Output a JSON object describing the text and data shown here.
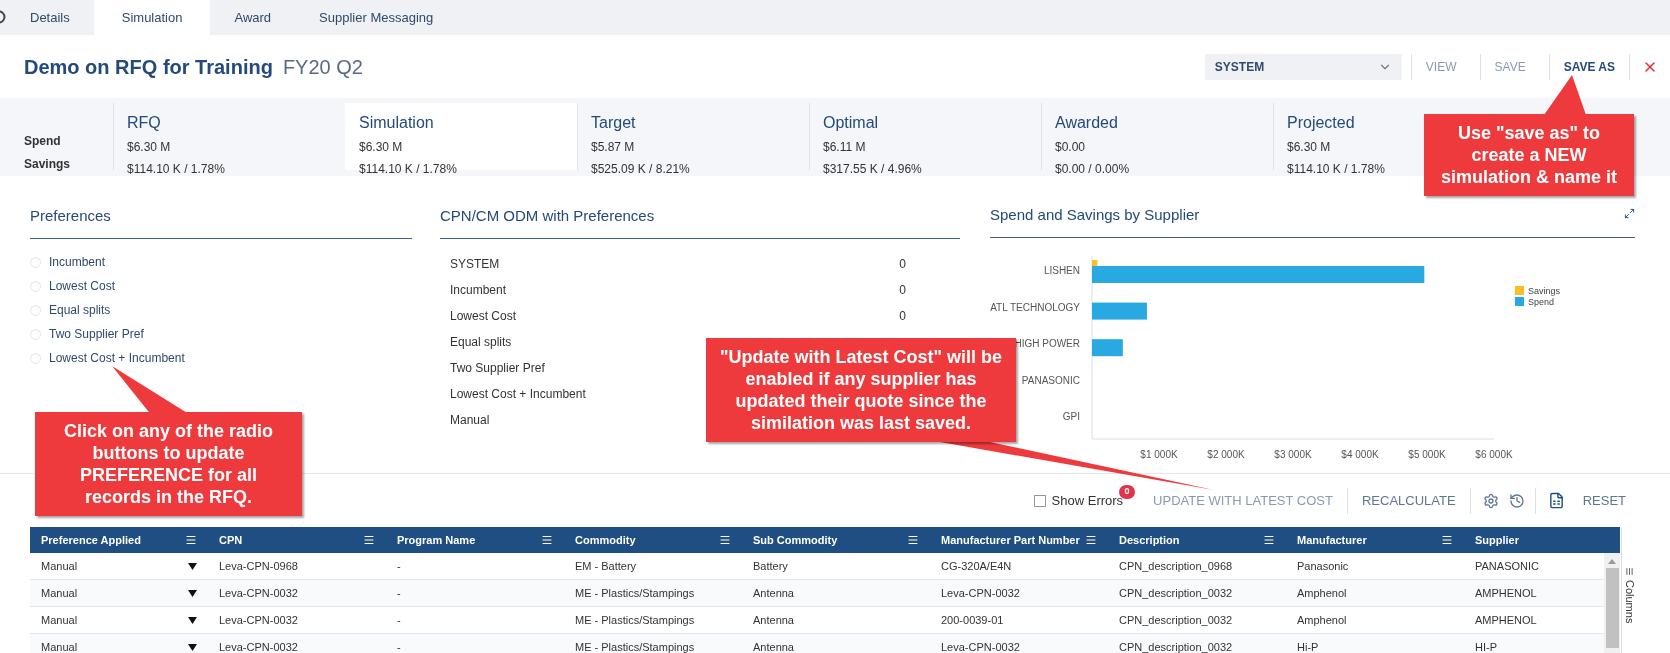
{
  "tabs": [
    {
      "label": "Details",
      "selected": false
    },
    {
      "label": "Simulation",
      "selected": true
    },
    {
      "label": "Award",
      "selected": false
    },
    {
      "label": "Supplier Messaging",
      "selected": false
    }
  ],
  "header": {
    "title": "Demo on RFQ for Training",
    "subtitle": "FY20 Q2",
    "view_select": "SYSTEM",
    "buttons": [
      {
        "label": "VIEW",
        "disabled": true
      },
      {
        "label": "SAVE",
        "disabled": true
      },
      {
        "label": "SAVE AS",
        "disabled": false
      }
    ]
  },
  "summary": {
    "row_labels": [
      "Spend",
      "Savings"
    ],
    "cards": [
      {
        "title": "RFQ",
        "spend": "$6.30 M",
        "savings": "$114.10 K / 1.78%",
        "selected": false
      },
      {
        "title": "Simulation",
        "spend": "$6.30 M",
        "savings": "$114.10 K / 1.78%",
        "selected": true
      },
      {
        "title": "Target",
        "spend": "$5.87 M",
        "savings": "$525.09 K / 8.21%",
        "selected": false
      },
      {
        "title": "Optimal",
        "spend": "$6.11 M",
        "savings": "$317.55 K / 4.96%",
        "selected": false
      },
      {
        "title": "Awarded",
        "spend": "$0.00",
        "savings": "$0.00 / 0.00%",
        "selected": false
      },
      {
        "title": "Projected",
        "spend": "$6.30 M",
        "savings": "$114.10 K / 1.78%",
        "selected": false
      }
    ]
  },
  "preferences": {
    "title": "Preferences",
    "options": [
      {
        "label": "Incumbent",
        "checked": false
      },
      {
        "label": "Lowest Cost",
        "checked": false
      },
      {
        "label": "Equal splits",
        "checked": false
      },
      {
        "label": "Two Supplier Pref",
        "checked": false
      },
      {
        "label": "Lowest Cost + Incumbent",
        "checked": false
      }
    ]
  },
  "cpn_panel": {
    "title": "CPN/CM ODM with Preferences",
    "rows": [
      {
        "label": "SYSTEM",
        "value": "0"
      },
      {
        "label": "Incumbent",
        "value": "0"
      },
      {
        "label": "Lowest Cost",
        "value": "0"
      },
      {
        "label": "Equal splits"
      },
      {
        "label": "Two Supplier Pref"
      },
      {
        "label": "Lowest Cost + Incumbent"
      },
      {
        "label": "Manual"
      }
    ]
  },
  "chart_panel": {
    "title": "Spend and Savings by Supplier",
    "chart_data": {
      "type": "bar",
      "orientation": "horizontal",
      "legend": "right",
      "categories": [
        "LISHEN",
        "ATL TECHNOLOGY",
        "HIGH POWER",
        "PANASONIC",
        "GPI"
      ],
      "series": [
        {
          "name": "Savings",
          "color": "#fbbf24",
          "values": [
            80,
            0,
            0,
            0,
            0
          ]
        },
        {
          "name": "Spend",
          "color": "#29a9e1",
          "values": [
            4960,
            820,
            460,
            0,
            0
          ]
        }
      ],
      "xlim": [
        0,
        6000
      ],
      "xticks": [
        {
          "value": 1000,
          "label": "$1 000K"
        },
        {
          "value": 2000,
          "label": "$2 000K"
        },
        {
          "value": 3000,
          "label": "$3 000K"
        },
        {
          "value": 4000,
          "label": "$4 000K"
        },
        {
          "value": 5000,
          "label": "$5 000K"
        },
        {
          "value": 6000,
          "label": "$6 000K"
        }
      ]
    }
  },
  "toolbar": {
    "show_errors": {
      "label": "Show Errors",
      "checked": false,
      "count": "0"
    },
    "buttons": [
      {
        "label": "UPDATE WITH LATEST COST",
        "disabled": true
      },
      {
        "label": "RECALCULATE",
        "disabled": false
      }
    ],
    "reset": "RESET"
  },
  "table": {
    "columns": [
      "Preference Applied",
      "CPN",
      "Program Name",
      "Commodity",
      "Sub Commodity",
      "Manufacturer Part Number",
      "Description",
      "Manufacturer",
      "Supplier"
    ],
    "rows": [
      [
        "Manual",
        "Leva-CPN-0968",
        "-",
        "EM - Battery",
        "Battery",
        "CG-320A/E4N",
        "CPN_description_0968",
        "Panasonic",
        "PANASONIC"
      ],
      [
        "Manual",
        "Leva-CPN-0032",
        "-",
        "ME - Plastics/Stampings",
        "Antenna",
        "Leva-CPN-0032",
        "CPN_description_0032",
        "Amphenol",
        "AMPHENOL"
      ],
      [
        "Manual",
        "Leva-CPN-0032",
        "-",
        "ME - Plastics/Stampings",
        "Antenna",
        "200-0039-01",
        "CPN_description_0032",
        "Amphenol",
        "AMPHENOL"
      ],
      [
        "Manual",
        "Leva-CPN-0032",
        "-",
        "ME - Plastics/Stampings",
        "Antenna",
        "Leva-CPN-0032",
        "CPN_description_0032",
        "Hi-P",
        "HI-P"
      ]
    ],
    "side_panel": "Columns"
  },
  "callouts": [
    "Use \"save as\" to create a NEW simulation & name it",
    "\"Update with Latest Cost\" will be enabled if any supplier has updated their quote since the similation was last saved.",
    "Click on any of the radio buttons to update PREFERENCE for all records in the RFQ."
  ]
}
